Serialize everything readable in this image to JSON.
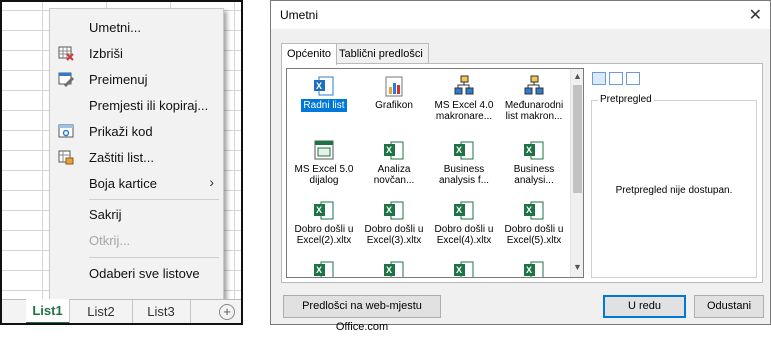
{
  "context_menu": {
    "items": [
      {
        "label": "Umetni...",
        "icon": "",
        "disabled": false
      },
      {
        "label": "Izbriši",
        "icon": "delete-sheet-icon",
        "disabled": false
      },
      {
        "label": "Preimenuj",
        "icon": "rename-sheet-icon",
        "disabled": false
      },
      {
        "label": "Premjesti ili kopiraj...",
        "icon": "",
        "disabled": false
      },
      {
        "label": "Prikaži kod",
        "icon": "view-code-icon",
        "disabled": false
      },
      {
        "label": "Zaštiti list...",
        "icon": "protect-sheet-icon",
        "disabled": false
      },
      {
        "label": "Boja kartice",
        "icon": "",
        "disabled": false,
        "submenu_arrow": "›"
      },
      {
        "label": "Sakrij",
        "icon": "",
        "disabled": false
      },
      {
        "label": "Otkrij...",
        "icon": "",
        "disabled": true
      },
      {
        "label": "Odaberi sve listove",
        "icon": "",
        "disabled": false
      }
    ]
  },
  "sheet_tabs": {
    "tabs": [
      "List1",
      "List2",
      "List3"
    ],
    "active": "List1",
    "add_symbol": "+"
  },
  "dialog": {
    "title": "Umetni",
    "close_symbol": "✕",
    "tabs": [
      "Općenito",
      "Tablični predlošci"
    ],
    "active_tab": "Općenito",
    "items": [
      {
        "label": "Radni list",
        "icon": "excel-worksheet-icon",
        "selected": true
      },
      {
        "label": "Grafikon",
        "icon": "chart-icon",
        "selected": false
      },
      {
        "label": "MS Excel 4.0 makronare...",
        "icon": "macro-sheet-icon",
        "selected": false
      },
      {
        "label": "Međunarodni list makron...",
        "icon": "international-macro-icon",
        "selected": false
      },
      {
        "label": "MS Excel 5.0 dijalog",
        "icon": "dialog-sheet-icon",
        "selected": false
      },
      {
        "label": "Analiza novčan...",
        "icon": "excel-template-icon",
        "selected": false
      },
      {
        "label": "Business analysis f...",
        "icon": "excel-template-icon",
        "selected": false
      },
      {
        "label": "Business analysi...",
        "icon": "excel-template-icon",
        "selected": false
      },
      {
        "label": "Dobro došli u Excel(2).xltx",
        "icon": "excel-template-icon",
        "selected": false
      },
      {
        "label": "Dobro došli u Excel(3).xltx",
        "icon": "excel-template-icon",
        "selected": false
      },
      {
        "label": "Dobro došli u Excel(4).xltx",
        "icon": "excel-template-icon",
        "selected": false
      },
      {
        "label": "Dobro došli u Excel(5).xltx",
        "icon": "excel-template-icon",
        "selected": false
      },
      {
        "label": "",
        "icon": "excel-template-icon",
        "selected": false
      },
      {
        "label": "",
        "icon": "excel-template-icon",
        "selected": false
      },
      {
        "label": "",
        "icon": "excel-template-icon",
        "selected": false
      },
      {
        "label": "",
        "icon": "excel-template-icon",
        "selected": false
      }
    ],
    "preview": {
      "label": "Pretpregled",
      "message": "Pretpregled nije dostupan."
    },
    "buttons": {
      "online_templates": "Predlošci na web-mjestu Office.com",
      "ok": "U redu",
      "cancel": "Odustani"
    }
  }
}
